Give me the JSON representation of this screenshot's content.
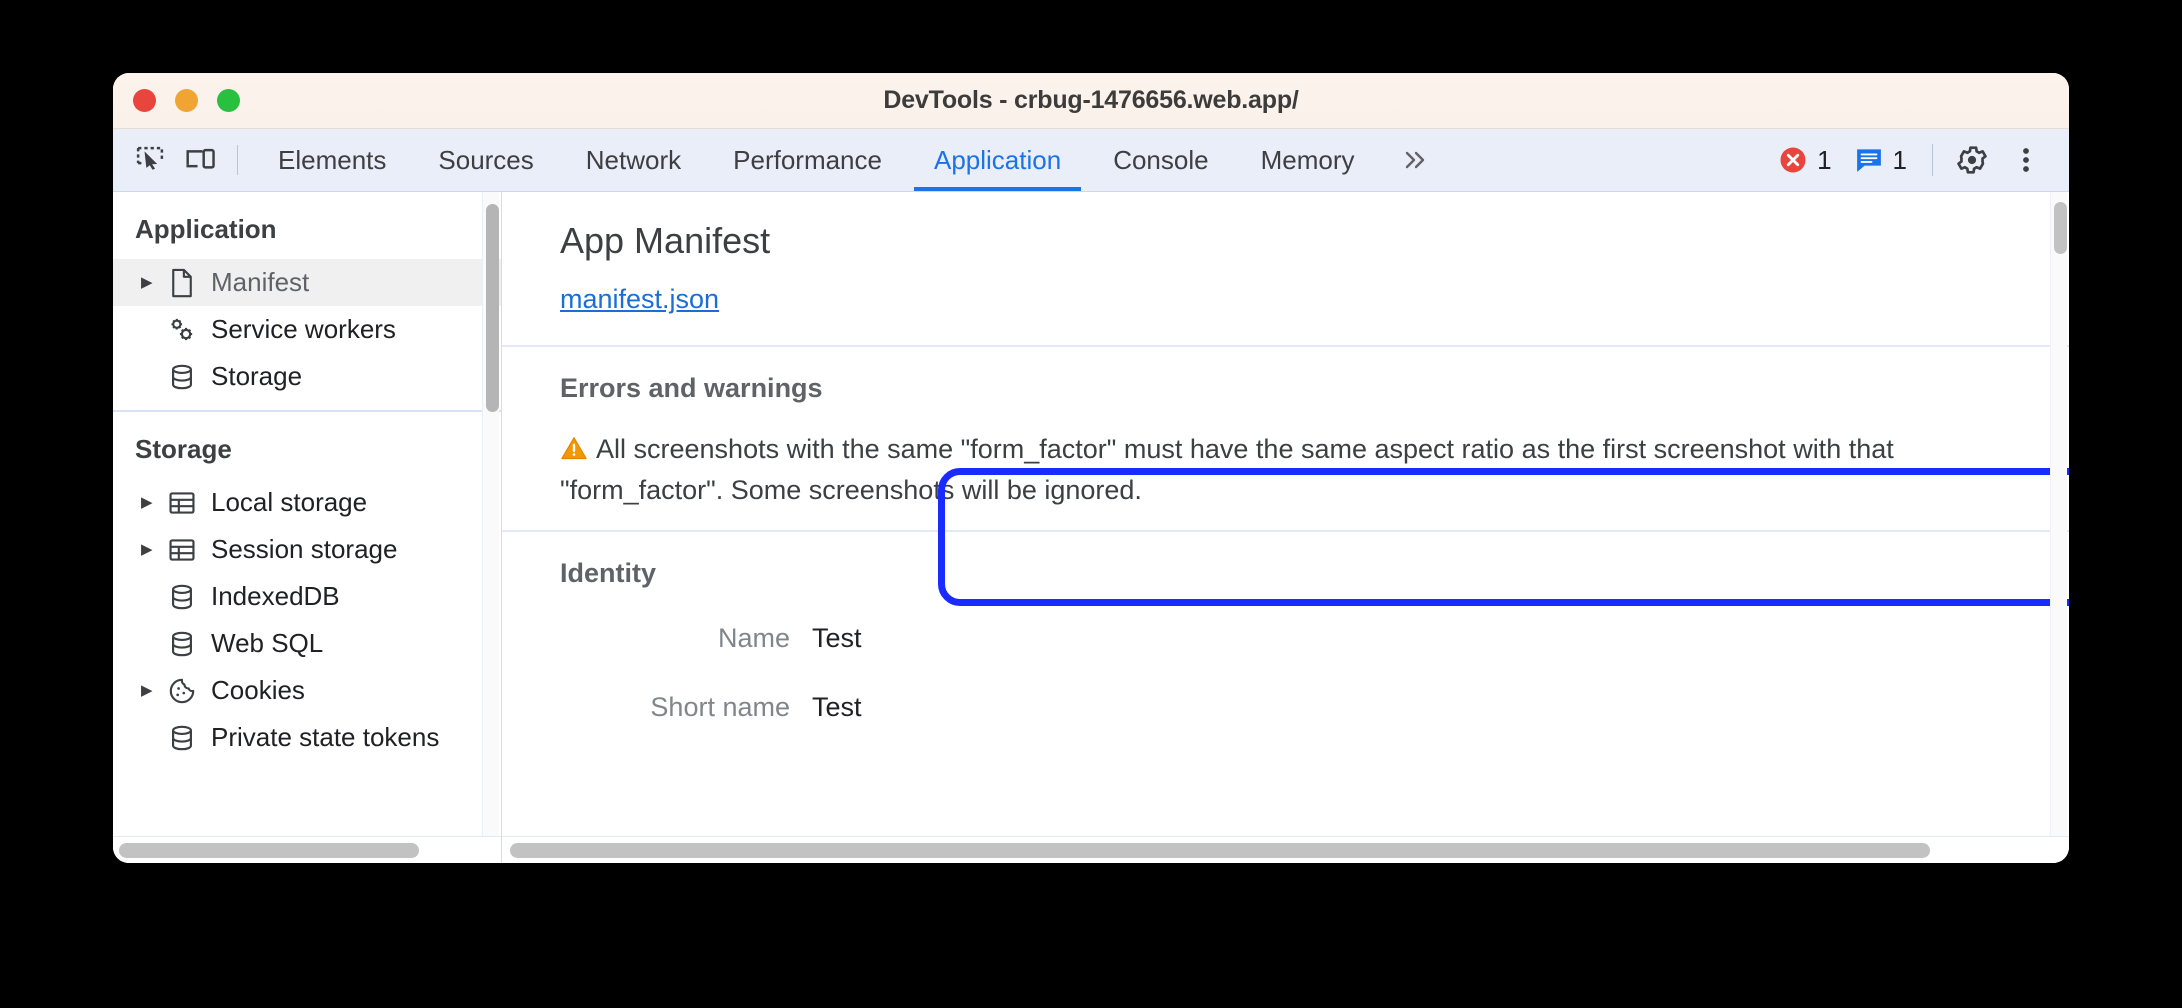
{
  "window": {
    "title": "DevTools - crbug-1476656.web.app/",
    "traffic_lights": [
      "close",
      "minimize",
      "maximize"
    ]
  },
  "toolbar": {
    "inspect_icon": "inspect-element-icon",
    "device_icon": "device-toolbar-icon",
    "tabs": [
      {
        "label": "Elements",
        "active": false
      },
      {
        "label": "Sources",
        "active": false
      },
      {
        "label": "Network",
        "active": false
      },
      {
        "label": "Performance",
        "active": false
      },
      {
        "label": "Application",
        "active": true
      },
      {
        "label": "Console",
        "active": false
      },
      {
        "label": "Memory",
        "active": false
      }
    ],
    "more_tabs_label": "»",
    "error_count": "1",
    "message_count": "1",
    "settings_icon": "gear-icon",
    "more_icon": "kebab-menu-icon",
    "accent_color": "#1a73e8",
    "error_color": "#e8453c",
    "message_color": "#1a73e8"
  },
  "sidebar": {
    "sections": [
      {
        "title": "Application",
        "items": [
          {
            "label": "Manifest",
            "icon": "document-icon",
            "expandable": true,
            "selected": true
          },
          {
            "label": "Service workers",
            "icon": "service-worker-gears-icon",
            "expandable": false,
            "selected": false
          },
          {
            "label": "Storage",
            "icon": "database-icon",
            "expandable": false,
            "selected": false
          }
        ]
      },
      {
        "title": "Storage",
        "items": [
          {
            "label": "Local storage",
            "icon": "table-icon",
            "expandable": true,
            "selected": false
          },
          {
            "label": "Session storage",
            "icon": "table-icon",
            "expandable": true,
            "selected": false
          },
          {
            "label": "IndexedDB",
            "icon": "database-icon",
            "expandable": false,
            "selected": false
          },
          {
            "label": "Web SQL",
            "icon": "database-icon",
            "expandable": false,
            "selected": false
          },
          {
            "label": "Cookies",
            "icon": "cookie-icon",
            "expandable": true,
            "selected": false
          },
          {
            "label": "Private state tokens",
            "icon": "database-icon",
            "expandable": false,
            "selected": false
          }
        ]
      }
    ]
  },
  "main": {
    "title": "App Manifest",
    "manifest_link": "manifest.json",
    "errors": {
      "heading": "Errors and warnings",
      "warning_icon": "warning-triangle-icon",
      "message": "All screenshots with the same \"form_factor\" must have the same aspect ratio as the first screenshot with that \"form_factor\". Some screenshots will be ignored.",
      "highlight_color": "#1a2bff",
      "warning_color": "#f29900"
    },
    "identity": {
      "heading": "Identity",
      "rows": [
        {
          "label": "Name",
          "value": "Test"
        },
        {
          "label": "Short name",
          "value": "Test"
        }
      ]
    }
  }
}
